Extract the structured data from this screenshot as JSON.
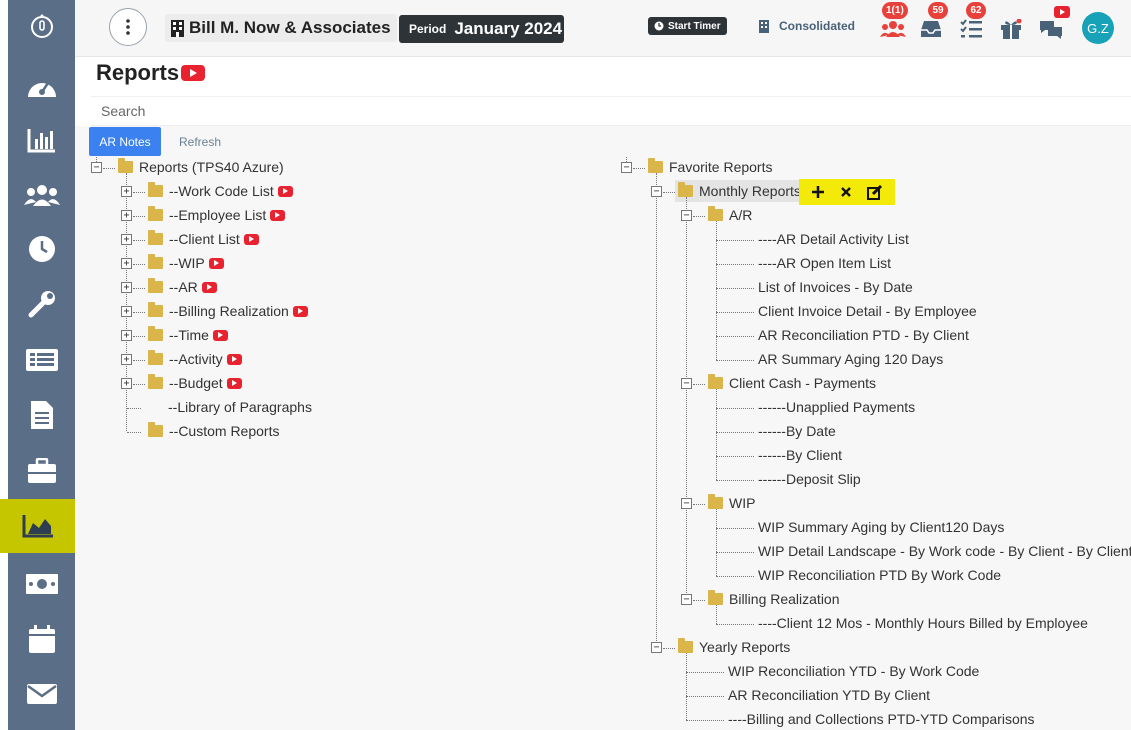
{
  "topbar": {
    "firm_name": "Bill M. Now & Associates",
    "period_label": "Period",
    "period_value": "January 2024",
    "start_timer_label": "Start Timer",
    "consolidated_label": "Consolidated",
    "badge_users": "1(1)",
    "badge_inbox": "59",
    "badge_tasks": "62",
    "avatar_initials": "G.Z"
  },
  "sidebar": {
    "items": [
      "logo-icon",
      "dashboard-icon",
      "chart-bar-icon",
      "users-icon",
      "clock-icon",
      "wrench-icon",
      "list-icon",
      "document-icon",
      "briefcase-icon",
      "area-chart-icon",
      "money-icon",
      "calendar-icon",
      "envelope-icon"
    ],
    "active": "area-chart-icon",
    "active_color": "#c6c600"
  },
  "page": {
    "title": "Reports",
    "search_placeholder": "Search",
    "ar_notes_label": "AR Notes",
    "refresh_label": "Refresh"
  },
  "left_tree": {
    "root": "Reports (TPS40 Azure)",
    "items": [
      "--Work Code List",
      "--Employee List",
      "--Client List",
      "--WIP",
      "--AR",
      "--Billing Realization",
      "--Time",
      "--Activity",
      "--Budget",
      "--Library of Paragraphs",
      "--Custom Reports"
    ]
  },
  "right_tree": {
    "root": "Favorite Reports",
    "monthly": "Monthly Reports",
    "ar_folder": "A/R",
    "ar_items": [
      "----AR Detail Activity List",
      "----AR Open Item List",
      "List of Invoices - By Date",
      "Client Invoice Detail - By Employee",
      "AR Reconciliation PTD - By Client",
      "AR Summary Aging 120 Days"
    ],
    "cash_folder": "Client Cash - Payments",
    "cash_items": [
      "------Unapplied Payments",
      "------By Date",
      "------By Client",
      "------Deposit Slip"
    ],
    "wip_folder": "WIP",
    "wip_items": [
      "WIP Summary Aging by Client120 Days",
      "WIP Detail Landscape - By Work code - By Client - By Client",
      "WIP Reconciliation PTD By Work Code"
    ],
    "billing_folder": "Billing Realization",
    "billing_items": [
      "----Client 12 Mos - Monthly Hours Billed by Employee"
    ],
    "yearly": "Yearly Reports",
    "yearly_items": [
      "WIP Reconciliation YTD - By Work Code",
      "AR Reconciliation YTD By Client",
      "----Billing and Collections PTD-YTD Comparisons"
    ]
  }
}
